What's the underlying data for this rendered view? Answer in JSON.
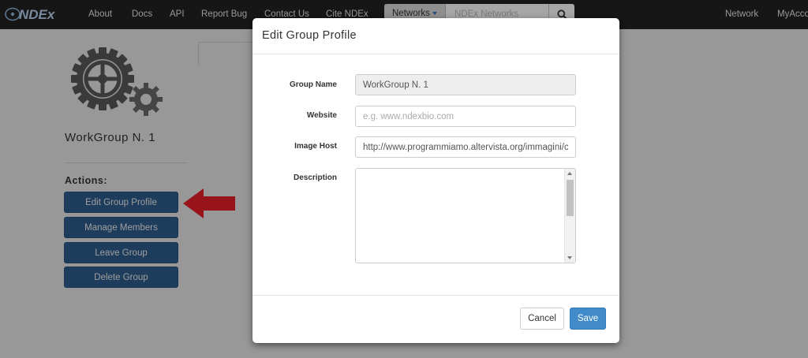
{
  "navbar": {
    "brand": "NDEx",
    "links": [
      "About",
      "Docs",
      "API",
      "Report Bug",
      "Contact Us",
      "Cite NDEx"
    ],
    "search": {
      "type_label": "Networks",
      "placeholder": "NDEx Networks"
    },
    "right_links": [
      "Network",
      "MyAcco"
    ]
  },
  "group": {
    "name": "WorkGroup N. 1",
    "actions_label": "Actions:",
    "actions": [
      "Edit Group Profile",
      "Manage Members",
      "Leave Group",
      "Delete Group"
    ]
  },
  "modal": {
    "title": "Edit Group Profile",
    "fields": {
      "group_name": {
        "label": "Group Name",
        "value": "WorkGroup N. 1"
      },
      "website": {
        "label": "Website",
        "value": "",
        "placeholder": "e.g. www.ndexbio.com"
      },
      "image_host": {
        "label": "Image Host",
        "value": "http://www.programmiamo.altervista.org/immagini/c"
      },
      "description": {
        "label": "Description",
        "value": ""
      }
    },
    "cancel_label": "Cancel",
    "save_label": "Save"
  },
  "colors": {
    "navbar_bg": "#222222",
    "action_button": "#2f5e8f",
    "primary": "#428bca",
    "highlight_arrow": "#e8202a"
  },
  "icons": [
    "ndex-logo-icon",
    "search-caret-icon",
    "magnifier-icon",
    "gear-icon",
    "red-arrow-icon"
  ]
}
